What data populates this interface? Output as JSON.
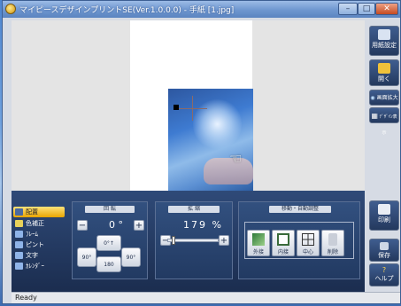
{
  "window": {
    "title": "マイピースデザインプリントSE(Ver.1.0.0.0) - 手紙 [1.jpg]",
    "minimize": "–",
    "maximize": "□",
    "close": "✕"
  },
  "right_toolbar": {
    "paper_settings": "用紙設定",
    "open": "開く",
    "zoom": "画面拡大",
    "show": "ﾃﾞｻﾞｲﾝ表示",
    "print": "印刷",
    "save": "保存",
    "help": "ヘルプ"
  },
  "side_menu": [
    {
      "label": "配置",
      "icon": "layout-icon",
      "active": true
    },
    {
      "label": "色補正",
      "icon": "color-correct-icon",
      "active": false
    },
    {
      "label": "ﾌﾚｰﾑ",
      "icon": "frame-icon",
      "active": false
    },
    {
      "label": "ピント",
      "icon": "focus-icon",
      "active": false
    },
    {
      "label": "文字",
      "icon": "text-icon",
      "active": false
    },
    {
      "label": "ｶﾚﾝﾀﾞｰ",
      "icon": "calendar-icon",
      "active": false
    }
  ],
  "rotate": {
    "title": "回 転",
    "minus": "−",
    "plus": "+",
    "value": "0 °",
    "reset": "0°↑",
    "rotate_left": "90°",
    "rotate_right": "90°",
    "rotate_180": "180"
  },
  "scale": {
    "title": "拡 縮",
    "value": "179 %",
    "minus": "−",
    "plus": "+",
    "slider_level": 0.1
  },
  "move": {
    "title": "移動・自動調整",
    "buttons": [
      {
        "label": "外接",
        "icon": "fit-outside-icon"
      },
      {
        "label": "内接",
        "icon": "fit-inside-icon"
      },
      {
        "label": "中心",
        "icon": "center-icon"
      },
      {
        "label": "削除",
        "icon": "trash-icon"
      }
    ]
  },
  "status": {
    "text": "Ready"
  },
  "colors": {
    "accent": "#e8a500",
    "panel": "#223a62",
    "titlebar": "#6e96cf"
  }
}
